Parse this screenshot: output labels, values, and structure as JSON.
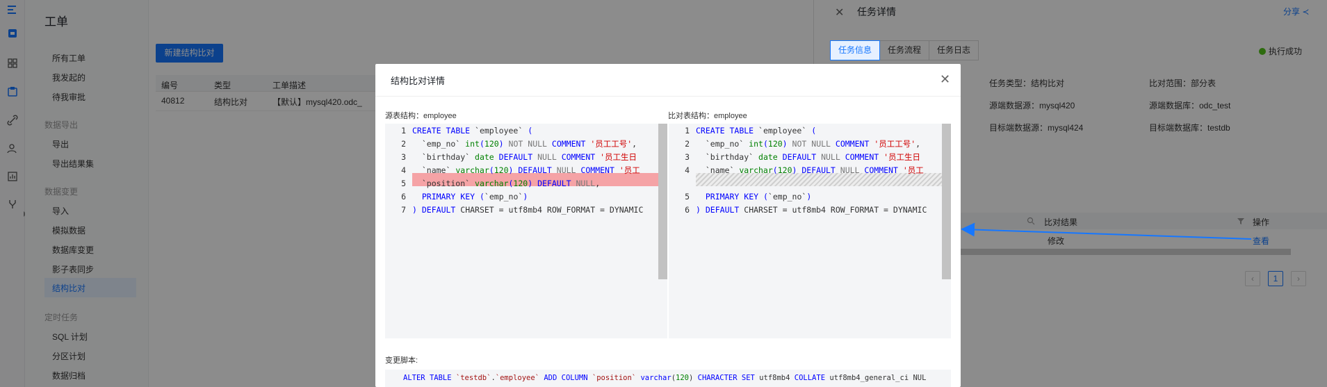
{
  "rail": {
    "icons": [
      "menu-icon",
      "database-icon",
      "grid-icon",
      "ticket-icon",
      "link-icon",
      "users-icon",
      "report-icon",
      "fork-icon",
      "expand-icon"
    ]
  },
  "menu": {
    "title": "工单",
    "items_top": [
      "所有工单",
      "我发起的",
      "待我审批"
    ],
    "group_export": "数据导出",
    "items_export": [
      "导出",
      "导出结果集"
    ],
    "group_change": "数据变更",
    "items_change": [
      "导入",
      "模拟数据",
      "数据库变更",
      "影子表同步",
      "结构比对"
    ],
    "group_schedule": "定时任务",
    "items_schedule": [
      "SQL 计划",
      "分区计划",
      "数据归档"
    ]
  },
  "main": {
    "new_button": "新建结构比对",
    "headers": [
      "编号",
      "类型",
      "工单描述"
    ],
    "row": [
      "40812",
      "结构比对",
      "【默认】mysql420.odc_"
    ]
  },
  "drawer": {
    "title": "任务详情",
    "share": "分享",
    "tabs": [
      "任务信息",
      "任务流程",
      "任务日志"
    ],
    "status": "执行成功",
    "info": {
      "task_type": "任务类型：结构比对",
      "scope": "比对范围：部分表",
      "src_ds": "源端数据源：mysql420",
      "src_db": "源端数据库：odc_test",
      "dst_ds": "目标端数据源：mysql424",
      "dst_db": "目标端数据库：testdb"
    },
    "table_headers": [
      "比对结果",
      "操作"
    ],
    "row_result": "修改",
    "row_action": "查看",
    "page": "1"
  },
  "modal": {
    "title": "结构比对详情",
    "source_label": "源表结构：employee",
    "target_label": "比对表结构：employee",
    "script_label": "变更脚本:",
    "script": "ALTER TABLE `testdb`.`employee` ADD COLUMN `position` varchar(120) CHARACTER SET utf8mb4 COLLATE utf8mb4_general_ci NUL"
  },
  "source_code": [
    {
      "no": "1",
      "text": "CREATE TABLE `employee` ("
    },
    {
      "no": "2",
      "text": "  `emp_no` int(120) NOT NULL COMMENT '员工工号',"
    },
    {
      "no": "3",
      "text": "  `birthday` date DEFAULT NULL COMMENT '员工生日"
    },
    {
      "no": "4",
      "text": "  `name` varchar(120) DEFAULT NULL COMMENT '员工"
    },
    {
      "no": "5",
      "text": "  `position` varchar(120) DEFAULT NULL,"
    },
    {
      "no": "6",
      "text": "  PRIMARY KEY (`emp_no`)"
    },
    {
      "no": "7",
      "text": ") DEFAULT CHARSET = utf8mb4 ROW_FORMAT = DYNAMIC"
    }
  ],
  "target_code": [
    {
      "no": "1",
      "text": "CREATE TABLE `employee` ("
    },
    {
      "no": "2",
      "text": "  `emp_no` int(120) NOT NULL COMMENT '员工工号',"
    },
    {
      "no": "3",
      "text": "  `birthday` date DEFAULT NULL COMMENT '员工生日"
    },
    {
      "no": "4",
      "text": "  `name` varchar(120) DEFAULT NULL COMMENT '员工"
    },
    {
      "no": "5",
      "text": "  PRIMARY KEY (`emp_no`)"
    },
    {
      "no": "6",
      "text": ") DEFAULT CHARSET = utf8mb4 ROW_FORMAT = DYNAMIC"
    }
  ],
  "colors": {
    "accent": "#1677ff",
    "deleted_line": "#f5a3a6",
    "success": "#52c41a"
  }
}
